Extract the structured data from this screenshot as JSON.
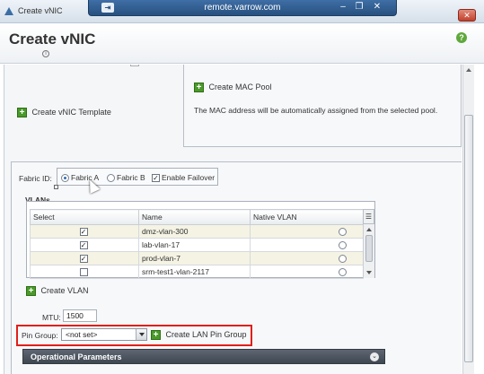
{
  "window": {
    "title": "Create vNIC",
    "remote_host": "remote.varrow.com",
    "pin_glyph": "⇥",
    "controls": {
      "minimize": "–",
      "restore": "❐",
      "close": "✕"
    },
    "win_close": "✕"
  },
  "header": {
    "title": "Create vNIC",
    "info_glyph": "i",
    "help_glyph": "?"
  },
  "links": {
    "create_vnic_template": "Create vNIC Template",
    "create_mac_pool": "Create MAC Pool",
    "create_vlan": "Create VLAN",
    "create_lan_pin_group": "Create LAN Pin Group"
  },
  "mac_note": "The MAC address will be automatically assigned from the selected pool.",
  "fabric": {
    "label": "Fabric ID:",
    "option_a": "Fabric A",
    "option_b": "Fabric B",
    "failover": "Enable Failover",
    "selected": "Fabric A",
    "failover_checked": true
  },
  "vlans": {
    "legend": "VLANs",
    "columns": [
      "Select",
      "Name",
      "Native VLAN"
    ],
    "rows": [
      {
        "selected": true,
        "name": "dmz-vlan-300",
        "native": false
      },
      {
        "selected": true,
        "name": "lab-vlan-17",
        "native": false
      },
      {
        "selected": true,
        "name": "prod-vlan-7",
        "native": false
      },
      {
        "selected": false,
        "name": "srm-test1-vlan-2117",
        "native": false
      }
    ]
  },
  "mtu": {
    "label": "MTU:",
    "value": "1500"
  },
  "pin_group": {
    "label": "Pin Group:",
    "value": "<not set>"
  },
  "operational": {
    "title": "Operational Parameters",
    "chevron": "⌄"
  },
  "icons": {
    "app": "triangle-icon",
    "add": "plus-icon",
    "help": "help-icon",
    "chevron": "chevron-down-icon"
  },
  "colors": {
    "highlight": "#e0201b",
    "add_green": "#4a9a2a",
    "section_bar": "#4a525d"
  }
}
